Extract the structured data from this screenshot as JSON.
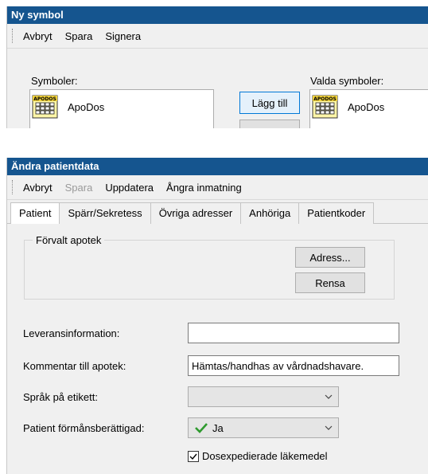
{
  "window1": {
    "title": "Ny symbol",
    "menu": [
      "Avbryt",
      "Spara",
      "Signera"
    ],
    "left_list": {
      "label": "Symboler:",
      "items": [
        "ApoDos"
      ]
    },
    "add_button": "Lägg till",
    "right_list": {
      "label": "Valda symboler:",
      "items": [
        "ApoDos"
      ]
    },
    "icon_label": "APODOS"
  },
  "window2": {
    "title": "Ändra patientdata",
    "menu": [
      {
        "label": "Avbryt",
        "enabled": true
      },
      {
        "label": "Spara",
        "enabled": false
      },
      {
        "label": "Uppdatera",
        "enabled": true
      },
      {
        "label": "Ångra inmatning",
        "enabled": true
      }
    ],
    "tabs": [
      "Patient",
      "Spärr/Sekretess",
      "Övriga adresser",
      "Anhöriga",
      "Patientkoder"
    ],
    "active_tab": "Patient",
    "group": {
      "title": "Förvalt apotek",
      "address_button": "Adress...",
      "clear_button": "Rensa"
    },
    "fields": {
      "leverans_label": "Leveransinformation:",
      "leverans_value": "",
      "kommentar_label": "Kommentar till apotek:",
      "kommentar_value": "Hämtas/handhas av vårdnadshavare.",
      "sprak_label": "Språk på etikett:",
      "sprak_value": "",
      "formans_label": "Patient förmånsberättigad:",
      "formans_value": "Ja",
      "dos_label": "Dosexpedierade läkemedel",
      "dos_checked": true
    }
  },
  "colors": {
    "titlebar": "#15558f",
    "check_green": "#2e9a2e",
    "focus_border": "#0078d7"
  }
}
